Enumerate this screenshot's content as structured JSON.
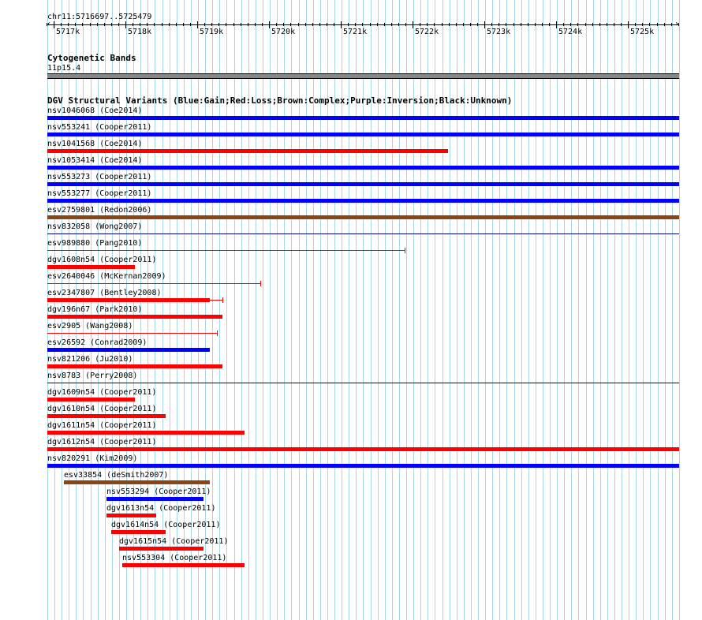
{
  "ruler": {
    "range_label": "chr11:5716697..5725479",
    "ticks": [
      "5717k",
      "5718k",
      "5719k",
      "5720k",
      "5721k",
      "5722k",
      "5723k",
      "5724k",
      "5725k"
    ]
  },
  "cytoband_track": {
    "title": "Cytogenetic Bands",
    "band_label": "11p15.4",
    "band_color": "#888888"
  },
  "dgv_track": {
    "title": "DGV Structural Variants (Blue:Gain;Red:Loss;Brown:Complex;Purple:Inversion;Black:Unknown)",
    "colors": {
      "gain": "#0000ff",
      "loss": "#ff0000",
      "complex": "#8b4513",
      "inversion": "#800080",
      "unknown": "#000000",
      "thin_blue": "#00008b"
    },
    "features": [
      {
        "label": "nsv1046068  (Coe2014)",
        "type": "gain"
      },
      {
        "label": "nsv553241  (Cooper2011)",
        "type": "gain"
      },
      {
        "label": "nsv1041568  (Coe2014)",
        "type": "loss"
      },
      {
        "label": "nsv1053414  (Coe2014)",
        "type": "gain"
      },
      {
        "label": "nsv553273  (Cooper2011)",
        "type": "gain"
      },
      {
        "label": "nsv553277  (Cooper2011)",
        "type": "gain"
      },
      {
        "label": "esv2759801  (Redon2006)",
        "type": "complex"
      },
      {
        "label": "nsv832058  (Wong2007)",
        "type": "gain"
      },
      {
        "label": "esv989880  (Pang2010)",
        "type": "loss"
      },
      {
        "label": "dgv1608n54  (Cooper2011)",
        "type": "loss"
      },
      {
        "label": "esv2640046  (McKernan2009)",
        "type": "loss"
      },
      {
        "label": "esv2347807  (Bentley2008)",
        "type": "loss"
      },
      {
        "label": "dgv196n67  (Park2010)",
        "type": "loss"
      },
      {
        "label": "esv2905  (Wang2008)",
        "type": "loss"
      },
      {
        "label": "esv26592  (Conrad2009)",
        "type": "gain"
      },
      {
        "label": "nsv821206  (Ju2010)",
        "type": "loss"
      },
      {
        "label": "nsv8783  (Perry2008)",
        "type": "gain"
      },
      {
        "label": "dgv1609n54  (Cooper2011)",
        "type": "loss"
      },
      {
        "label": "dgv1610n54  (Cooper2011)",
        "type": "loss"
      },
      {
        "label": "dgv1611n54  (Cooper2011)",
        "type": "loss"
      },
      {
        "label": "dgv1612n54  (Cooper2011)",
        "type": "loss"
      },
      {
        "label": "nsv820291  (Kim2009)",
        "type": "gain"
      },
      {
        "label": "esv33854  (deSmith2007)",
        "type": "complex"
      },
      {
        "label": "nsv553294  (Cooper2011)",
        "type": "gain"
      },
      {
        "label": "dgv1613n54  (Cooper2011)",
        "type": "loss"
      },
      {
        "label": "dgv1614n54  (Cooper2011)",
        "type": "loss"
      },
      {
        "label": "dgv1615n54  (Cooper2011)",
        "type": "loss"
      },
      {
        "label": "nsv553304  (Cooper2011)",
        "type": "loss"
      }
    ]
  }
}
